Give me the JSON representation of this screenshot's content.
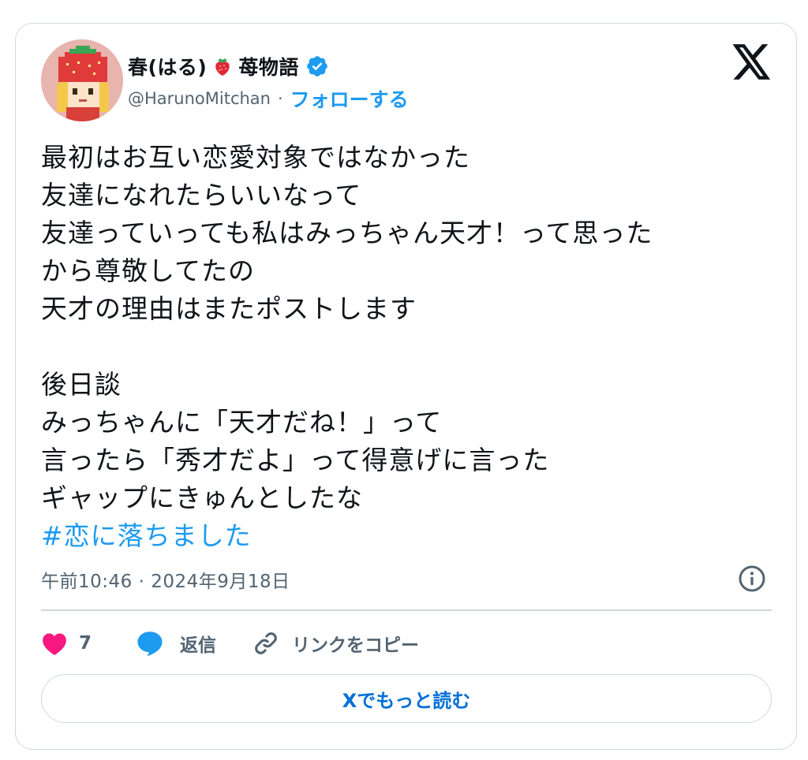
{
  "author": {
    "display_name": "春(はる)",
    "display_name_suffix": "苺物語",
    "handle": "@HarunoMitchan",
    "separator": "·",
    "follow_label": "フォローする"
  },
  "tweet": {
    "lines": [
      "最初はお互い恋愛対象ではなかった",
      "友達になれたらいいなって",
      "友達っていっても私はみっちゃん天才！って思った",
      "から尊敬してたの",
      "天才の理由はまたポストします",
      "",
      "後日談",
      "みっちゃんに「天才だね！」って",
      "言ったら「秀才だよ」って得意げに言った",
      "ギャップにきゅんとしたな"
    ],
    "hashtag": "#恋に落ちました"
  },
  "timestamp": "午前10:46 · 2024年9月18日",
  "actions": {
    "like_count": "7",
    "reply_label": "返信",
    "copy_link_label": "リンクをコピー"
  },
  "read_more_label": "Xでもっと読む",
  "colors": {
    "accent": "#1d9bf0",
    "like": "#f91880",
    "text": "#0f1419",
    "muted": "#536471",
    "border": "#cfd9de"
  }
}
